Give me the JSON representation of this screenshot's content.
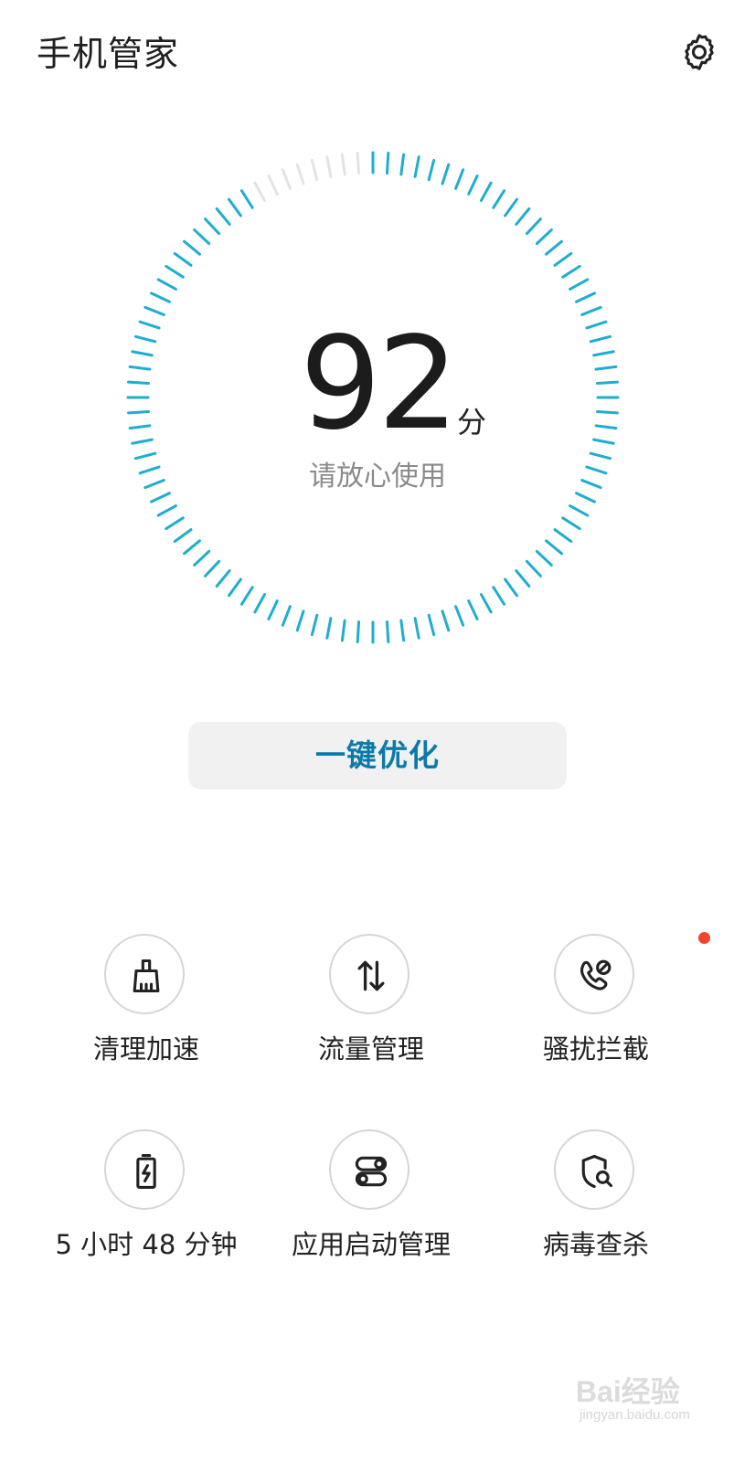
{
  "header": {
    "title": "手机管家",
    "settings_icon": "gear-icon"
  },
  "score": {
    "value": "92",
    "unit": "分",
    "status": "请放心使用",
    "dial_progress": 0.92,
    "dial_active_color": "#1eaed0",
    "dial_inactive_color": "#e3e3e3"
  },
  "optimize_button": {
    "label": "一键优化",
    "color": "#0b7aa8"
  },
  "features": [
    {
      "label": "清理加速",
      "icon": "broom-icon",
      "badge": false
    },
    {
      "label": "流量管理",
      "icon": "up-down-arrows-icon",
      "badge": false
    },
    {
      "label": "骚扰拦截",
      "icon": "blocked-phone-icon",
      "badge": true
    },
    {
      "label": "5 小时 48 分钟",
      "icon": "battery-icon",
      "badge": false
    },
    {
      "label": "应用启动管理",
      "icon": "toggle-switches-icon",
      "badge": false
    },
    {
      "label": "病毒查杀",
      "icon": "shield-search-icon",
      "badge": false
    }
  ],
  "badge_color": "#f2452f",
  "watermark": {
    "brand": "Bai经验",
    "url": "jingyan.baidu.com"
  }
}
